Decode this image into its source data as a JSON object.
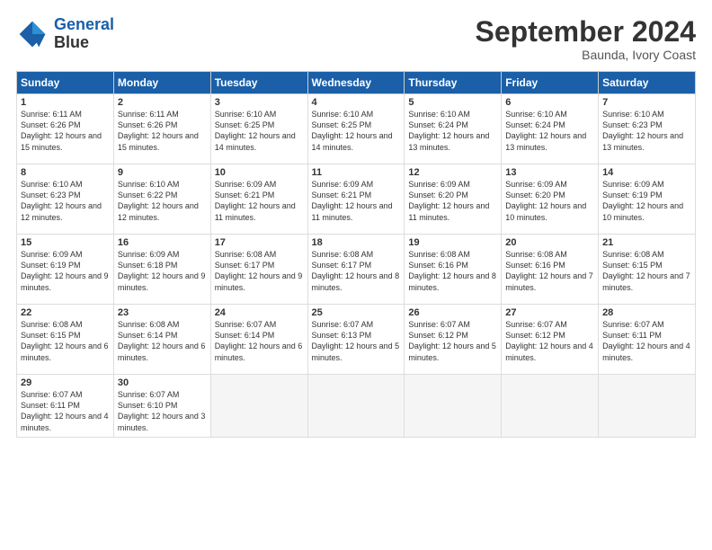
{
  "logo": {
    "line1": "General",
    "line2": "Blue"
  },
  "title": "September 2024",
  "subtitle": "Baunda, Ivory Coast",
  "days_of_week": [
    "Sunday",
    "Monday",
    "Tuesday",
    "Wednesday",
    "Thursday",
    "Friday",
    "Saturday"
  ],
  "weeks": [
    [
      {
        "day": "1",
        "sunrise": "6:11 AM",
        "sunset": "6:26 PM",
        "daylight": "12 hours and 15 minutes."
      },
      {
        "day": "2",
        "sunrise": "6:11 AM",
        "sunset": "6:26 PM",
        "daylight": "12 hours and 15 minutes."
      },
      {
        "day": "3",
        "sunrise": "6:10 AM",
        "sunset": "6:25 PM",
        "daylight": "12 hours and 14 minutes."
      },
      {
        "day": "4",
        "sunrise": "6:10 AM",
        "sunset": "6:25 PM",
        "daylight": "12 hours and 14 minutes."
      },
      {
        "day": "5",
        "sunrise": "6:10 AM",
        "sunset": "6:24 PM",
        "daylight": "12 hours and 13 minutes."
      },
      {
        "day": "6",
        "sunrise": "6:10 AM",
        "sunset": "6:24 PM",
        "daylight": "12 hours and 13 minutes."
      },
      {
        "day": "7",
        "sunrise": "6:10 AM",
        "sunset": "6:23 PM",
        "daylight": "12 hours and 13 minutes."
      }
    ],
    [
      {
        "day": "8",
        "sunrise": "6:10 AM",
        "sunset": "6:23 PM",
        "daylight": "12 hours and 12 minutes."
      },
      {
        "day": "9",
        "sunrise": "6:10 AM",
        "sunset": "6:22 PM",
        "daylight": "12 hours and 12 minutes."
      },
      {
        "day": "10",
        "sunrise": "6:09 AM",
        "sunset": "6:21 PM",
        "daylight": "12 hours and 11 minutes."
      },
      {
        "day": "11",
        "sunrise": "6:09 AM",
        "sunset": "6:21 PM",
        "daylight": "12 hours and 11 minutes."
      },
      {
        "day": "12",
        "sunrise": "6:09 AM",
        "sunset": "6:20 PM",
        "daylight": "12 hours and 11 minutes."
      },
      {
        "day": "13",
        "sunrise": "6:09 AM",
        "sunset": "6:20 PM",
        "daylight": "12 hours and 10 minutes."
      },
      {
        "day": "14",
        "sunrise": "6:09 AM",
        "sunset": "6:19 PM",
        "daylight": "12 hours and 10 minutes."
      }
    ],
    [
      {
        "day": "15",
        "sunrise": "6:09 AM",
        "sunset": "6:19 PM",
        "daylight": "12 hours and 9 minutes."
      },
      {
        "day": "16",
        "sunrise": "6:09 AM",
        "sunset": "6:18 PM",
        "daylight": "12 hours and 9 minutes."
      },
      {
        "day": "17",
        "sunrise": "6:08 AM",
        "sunset": "6:17 PM",
        "daylight": "12 hours and 9 minutes."
      },
      {
        "day": "18",
        "sunrise": "6:08 AM",
        "sunset": "6:17 PM",
        "daylight": "12 hours and 8 minutes."
      },
      {
        "day": "19",
        "sunrise": "6:08 AM",
        "sunset": "6:16 PM",
        "daylight": "12 hours and 8 minutes."
      },
      {
        "day": "20",
        "sunrise": "6:08 AM",
        "sunset": "6:16 PM",
        "daylight": "12 hours and 7 minutes."
      },
      {
        "day": "21",
        "sunrise": "6:08 AM",
        "sunset": "6:15 PM",
        "daylight": "12 hours and 7 minutes."
      }
    ],
    [
      {
        "day": "22",
        "sunrise": "6:08 AM",
        "sunset": "6:15 PM",
        "daylight": "12 hours and 6 minutes."
      },
      {
        "day": "23",
        "sunrise": "6:08 AM",
        "sunset": "6:14 PM",
        "daylight": "12 hours and 6 minutes."
      },
      {
        "day": "24",
        "sunrise": "6:07 AM",
        "sunset": "6:14 PM",
        "daylight": "12 hours and 6 minutes."
      },
      {
        "day": "25",
        "sunrise": "6:07 AM",
        "sunset": "6:13 PM",
        "daylight": "12 hours and 5 minutes."
      },
      {
        "day": "26",
        "sunrise": "6:07 AM",
        "sunset": "6:12 PM",
        "daylight": "12 hours and 5 minutes."
      },
      {
        "day": "27",
        "sunrise": "6:07 AM",
        "sunset": "6:12 PM",
        "daylight": "12 hours and 4 minutes."
      },
      {
        "day": "28",
        "sunrise": "6:07 AM",
        "sunset": "6:11 PM",
        "daylight": "12 hours and 4 minutes."
      }
    ],
    [
      {
        "day": "29",
        "sunrise": "6:07 AM",
        "sunset": "6:11 PM",
        "daylight": "12 hours and 4 minutes."
      },
      {
        "day": "30",
        "sunrise": "6:07 AM",
        "sunset": "6:10 PM",
        "daylight": "12 hours and 3 minutes."
      },
      null,
      null,
      null,
      null,
      null
    ]
  ]
}
